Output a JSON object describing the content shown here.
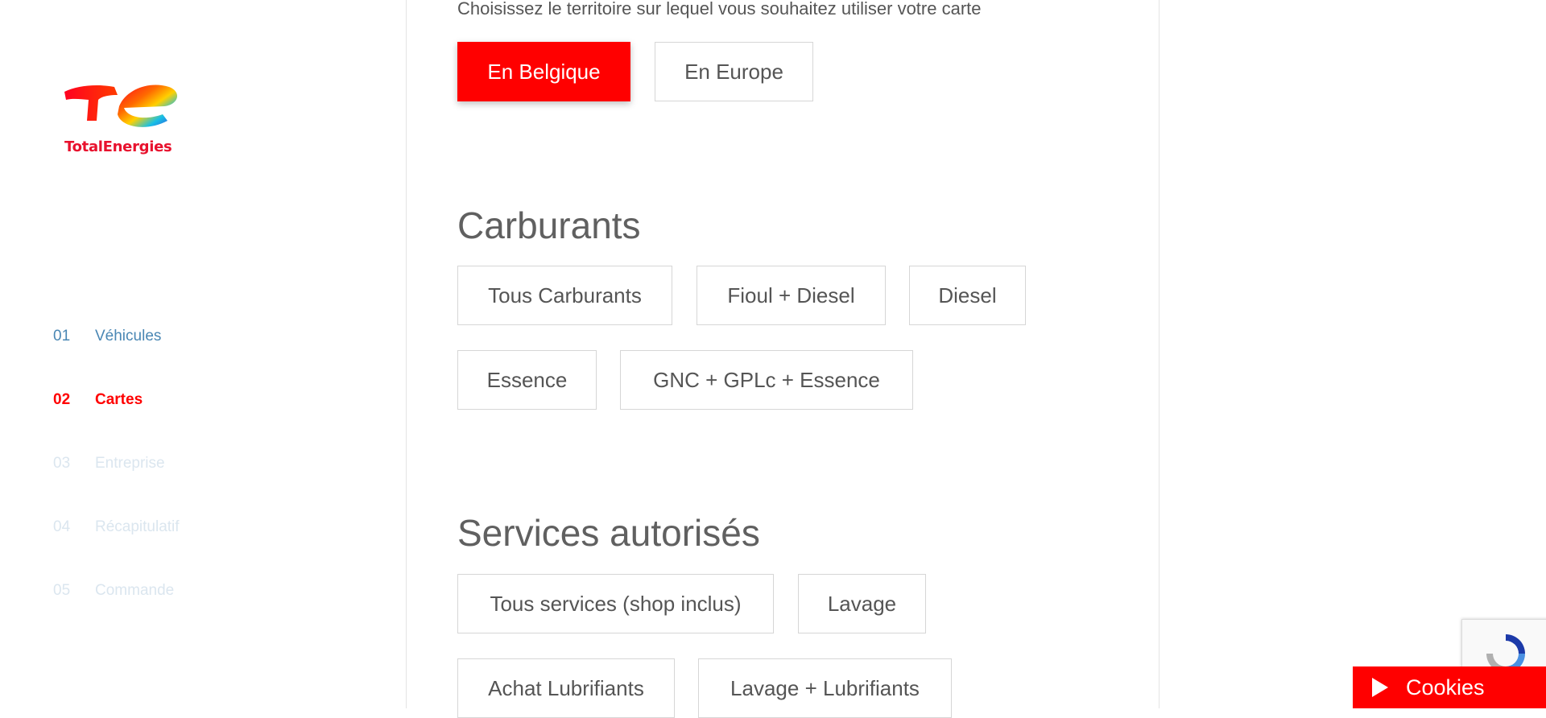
{
  "brand": {
    "name": "TotalEnergies"
  },
  "steps": [
    {
      "num": "01",
      "label": "Véhicules",
      "state": "done"
    },
    {
      "num": "02",
      "label": "Cartes",
      "state": "active"
    },
    {
      "num": "03",
      "label": "Entreprise",
      "state": "todo"
    },
    {
      "num": "04",
      "label": "Récapitulatif",
      "state": "todo"
    },
    {
      "num": "05",
      "label": "Commande",
      "state": "todo"
    }
  ],
  "territory": {
    "intro": "Choisissez le territoire sur lequel vous souhaitez utiliser votre carte",
    "options": [
      "En Belgique",
      "En Europe"
    ],
    "selected": "En Belgique"
  },
  "fuels": {
    "title": "Carburants",
    "options": [
      "Tous Carburants",
      "Fioul + Diesel",
      "Diesel",
      "Essence",
      "GNC + GPLc + Essence"
    ]
  },
  "services": {
    "title": "Services autorisés",
    "options": [
      "Tous services (shop inclus)",
      "Lavage",
      "Achat Lubrifiants",
      "Lavage + Lubrifiants"
    ]
  },
  "cookies": {
    "label": "Cookies",
    "icon": "play-icon"
  },
  "colors": {
    "accent": "#ff0000",
    "done": "#4a87b4",
    "todo": "#dbe6ef"
  }
}
